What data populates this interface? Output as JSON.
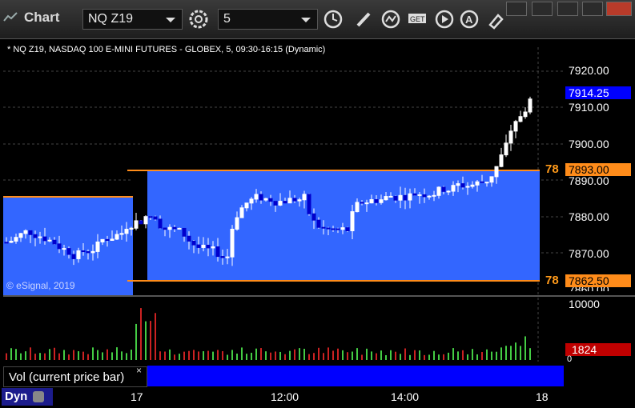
{
  "app": {
    "title": "Chart"
  },
  "toolbar": {
    "symbol": "NQ Z19",
    "interval": "5",
    "icons": [
      "settings-icon",
      "clock-icon",
      "pencil-icon",
      "indicator-icon",
      "get-icon",
      "play-icon",
      "alert-icon",
      "link-icon"
    ]
  },
  "chart": {
    "subtitle": "* NQ Z19, NASDAQ 100 E-MINI FUTURES - GLOBEX, 5, 09:30-16:15 (Dynamic)",
    "copyright": "© eSignal, 2019",
    "price_axis": [
      "7920.00",
      "7910.00",
      "7900.00",
      "7890.00",
      "7880.00",
      "7870.00",
      "7860.00"
    ],
    "last_price": "7914.25",
    "level_high": "7893.00",
    "level_low": "7862.50",
    "level_prefix": "78",
    "volume_axis": "10000",
    "volume_last": "1824",
    "volume_zero": "0",
    "study_label": "Vol (current price bar)",
    "study_close": "×",
    "time_labels": [
      "17",
      "12:00",
      "14:00",
      "18"
    ],
    "dyn_label": "Dyn",
    "colors": {
      "zone": "#3366ff",
      "level": "#ff8c1a",
      "price_tag": "#0000ff",
      "volume_tag": "#c00000"
    }
  }
}
